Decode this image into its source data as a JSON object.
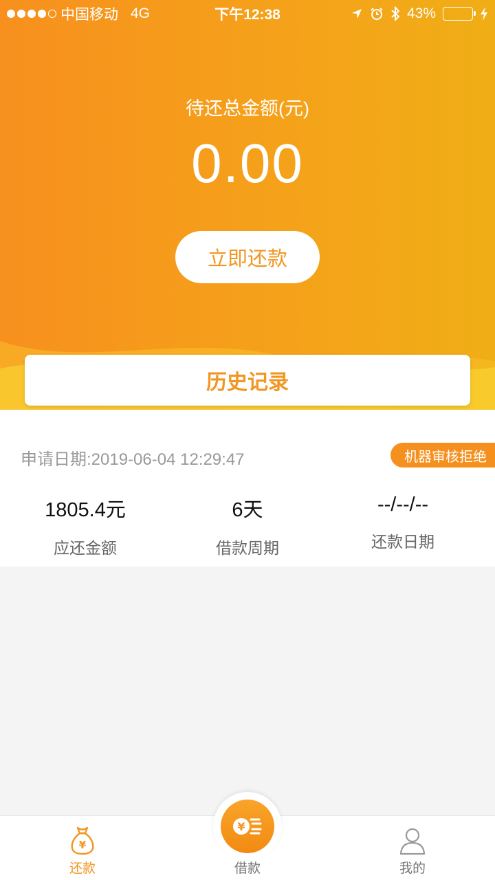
{
  "status_bar": {
    "carrier": "中国移动",
    "network": "4G",
    "time": "下午12:38",
    "battery": "43%",
    "battery_level": 0.43
  },
  "summary": {
    "total_label": "待还总金额(元)",
    "total_amount": "0.00",
    "repay_button": "立即还款"
  },
  "history": {
    "title": "历史记录"
  },
  "record": {
    "apply_date": "申请日期:2019-06-04 12:29:47",
    "status": "机器审核拒绝",
    "amount_value": "1805.4元",
    "amount_label": "应还金额",
    "period_value": "6天",
    "period_label": "借款周期",
    "repay_date_value": "--/--/--",
    "repay_date_label": "还款日期"
  },
  "tabbar": {
    "items": [
      {
        "label": "还款",
        "icon": "money-bag-icon"
      },
      {
        "label": "借款",
        "icon": "coin-icon"
      },
      {
        "label": "我的",
        "icon": "user-icon"
      }
    ]
  },
  "colors": {
    "accent": "#f29622",
    "hero_start": "#f7901e",
    "hero_end": "#f0ae16",
    "battery_fill": "#4cd964"
  }
}
